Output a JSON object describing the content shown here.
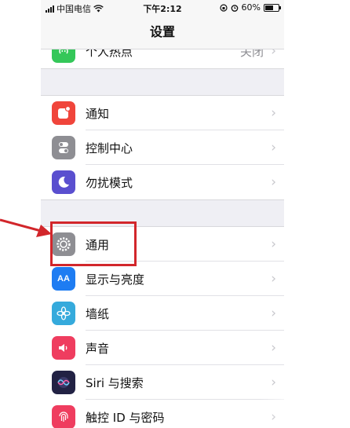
{
  "status_bar": {
    "carrier": "中国电信",
    "time": "下午2:12",
    "battery": "60%",
    "battery_level": 0.6
  },
  "nav": {
    "title": "设置"
  },
  "rows": [
    {
      "label": "个人热点",
      "value": "关闭",
      "icon": "hotspot-icon",
      "color": "#34c759"
    },
    {
      "label": "通知",
      "icon": "notifications-icon",
      "color": "#f0453b"
    },
    {
      "label": "控制中心",
      "icon": "control-center-icon",
      "color": "#8e8e93"
    },
    {
      "label": "勿扰模式",
      "icon": "moon-icon",
      "color": "#5a4fcf"
    },
    {
      "label": "通用",
      "icon": "gear-icon",
      "color": "#8e8e93"
    },
    {
      "label": "显示与亮度",
      "icon": "display-icon",
      "color": "#1e7cf2"
    },
    {
      "label": "墙纸",
      "icon": "wallpaper-icon",
      "color": "#35aadc"
    },
    {
      "label": "声音",
      "icon": "sound-icon",
      "color": "#ef3d5f"
    },
    {
      "label": "Siri 与搜索",
      "icon": "siri-icon",
      "color": "#222244"
    },
    {
      "label": "触控 ID 与密码",
      "icon": "fingerprint-icon",
      "color": "#ef3d5f"
    }
  ],
  "chevron": "›",
  "annotation_color": "#d2262b"
}
